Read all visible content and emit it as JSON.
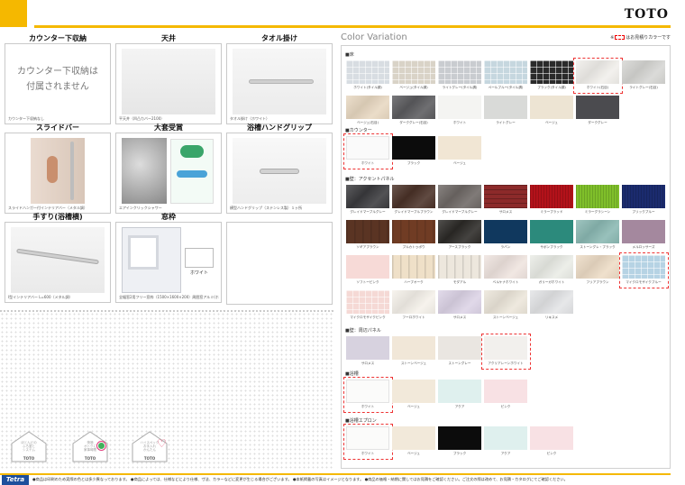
{
  "header": {
    "brand": "TOTO",
    "accent_color": "#f5b800"
  },
  "features": [
    {
      "title": "カウンター下収納",
      "note": "カウンター下収納は\n付属されません",
      "caption": "カウンター下収納なし"
    },
    {
      "title": "天井",
      "caption": "平天井（凹凸カバー2100）"
    },
    {
      "title": "タオル掛け",
      "caption": "タオル掛け（ホワイト）"
    },
    {
      "title": "スライドバー",
      "caption": "スライドハンガー付インテリアバー（メタル調）"
    },
    {
      "title": "大套受賞",
      "caption": "エアインクリックシャワー"
    },
    {
      "title": "浴槽ハンドグリップ",
      "caption": "横型ハンドグリップ（ステンレス製）１ヶ所"
    },
    {
      "title": "手すり(浴槽横)",
      "caption": "I型インテリアバー L=600（メタル調）"
    },
    {
      "title": "窓枠",
      "caption": "全幅窓2用フリー窓枠（1500×1600×200）周囲窓アルミ(ホワイト)",
      "badge": "ホワイト"
    }
  ],
  "houses": [
    {
      "label": "ほとんどの\nふろ釜と\nシステム",
      "brand": "TOTO"
    },
    {
      "label": "快適\nオトクに\n家事時間",
      "brand": "TOTO"
    },
    {
      "label": "ハイスペック\nお手入れ\nかんたん",
      "brand": "TOTO"
    }
  ],
  "color_variation": {
    "title": "Color Variation",
    "note_prefix": "※",
    "note_suffix": "はお見積りカラーです",
    "sections": [
      {
        "name": "床",
        "rows": [
          [
            {
              "l": "ホワイト(タイル調)",
              "c": "#d8dde2",
              "p": "grid"
            },
            {
              "l": "ベージュ(タイル調)",
              "c": "#d9d3c7",
              "p": "grid"
            },
            {
              "l": "ライトグレー(タイル調)",
              "c": "#c9ccd0",
              "p": "grid"
            },
            {
              "l": "ペールブルー(タイル調)",
              "c": "#c6d7df",
              "p": "grid"
            },
            {
              "l": "ブラック(タイル調)",
              "c": "#2a2a2a",
              "p": "grid"
            },
            {
              "l": "ホワイト(石目)",
              "c": "#f1efeb",
              "p": "stone",
              "sel": true
            },
            {
              "l": "ライトグレー(石目)",
              "c": "#d6d6d3",
              "p": "stone"
            }
          ],
          [
            {
              "l": "ベージュ(石目)",
              "c": "#e8d8c1",
              "p": "stone"
            },
            {
              "l": "ダークグレー(石目)",
              "c": "#5b5b5e",
              "p": "stone"
            },
            {
              "l": "ホワイト",
              "c": "#f4f4f2"
            },
            {
              "l": "ライトグレー",
              "c": "#d9dad8"
            },
            {
              "l": "ベージュ",
              "c": "#ede4d3"
            },
            {
              "l": "ダークグレー",
              "c": "#4b4b4f"
            }
          ]
        ]
      },
      {
        "name": "カウンター",
        "rows": [
          [
            {
              "l": "ホワイト",
              "c": "#fafafa",
              "sel": true
            },
            {
              "l": "ブラック",
              "c": "#0c0c0c"
            },
            {
              "l": "ベージュ",
              "c": "#f1e6d4"
            }
          ]
        ]
      },
      {
        "name": "壁：アクセントパネル",
        "rows": [
          [
            {
              "l": "グレイドマーブルグレー",
              "c": "#3a3a3d",
              "p": "stone"
            },
            {
              "l": "グレイドマーブルブラウン",
              "c": "#4a3127",
              "p": "stone"
            },
            {
              "l": "グレイドマーブルグレー",
              "c": "#6e6865",
              "p": "stone"
            },
            {
              "l": "サロメス",
              "c": "#8c2a2a",
              "p": "brick"
            },
            {
              "l": "ミラーブラッド",
              "c": "#b3121a",
              "p": "stripe"
            },
            {
              "l": "ミラーグラシーン",
              "c": "#7fbf2a",
              "p": "stripe"
            },
            {
              "l": "ブリックブルー",
              "c": "#1b2b6e",
              "p": "stripe"
            }
          ],
          [
            {
              "l": "ソギアブラウン",
              "c": "#5a3423",
              "p": "wood"
            },
            {
              "l": "ブルカトゥボウ",
              "c": "#703c24",
              "p": "wood"
            },
            {
              "l": "アースブラック",
              "c": "#2b2926",
              "p": "stone"
            },
            {
              "l": "ラバン",
              "c": "#10385e"
            },
            {
              "l": "サボンブラック",
              "c": "#2c8a7c"
            },
            {
              "l": "ストーングレ・ブラック",
              "c": "#8ab8b2",
              "p": "stone"
            },
            {
              "l": "メルロッサーズ",
              "c": "#a4889e"
            }
          ],
          [
            {
              "l": "ソフトーピンク",
              "c": "#f7dad7"
            },
            {
              "l": "ハーブオーク",
              "c": "#efe0c8",
              "p": "wood"
            },
            {
              "l": "モダアル",
              "c": "#ede7dd",
              "p": "wood"
            },
            {
              "l": "ベルケナホワイト",
              "c": "#efe4df",
              "p": "stone"
            },
            {
              "l": "ガリーガホワイト",
              "c": "#eaece6",
              "p": "stone"
            },
            {
              "l": "フリアブラウン",
              "c": "#eddcc6",
              "p": "stone"
            },
            {
              "l": "マイクロモザイクブルー",
              "c": "#b6d3e4",
              "p": "grid",
              "sel": true
            }
          ],
          [
            {
              "l": "マイクロモザイクピンク",
              "c": "#f5d9d5",
              "p": "grid"
            },
            {
              "l": "フーロホワイト",
              "c": "#f5f1ea",
              "p": "stone"
            },
            {
              "l": "サロメス",
              "c": "#dcd3e6",
              "p": "stone"
            },
            {
              "l": "ストーンベージュ",
              "c": "#ece6da",
              "p": "stone"
            },
            {
              "l": "リキスメ",
              "c": "#e3e4e6",
              "p": "stone"
            }
          ]
        ]
      },
      {
        "name": "壁：周辺パネル",
        "rows": [
          [
            {
              "l": "サロメス",
              "c": "#d7d2df"
            },
            {
              "l": "ストーンベージュ",
              "c": "#f1e7d8"
            },
            {
              "l": "ストーングレー",
              "c": "#eae6e1"
            },
            {
              "l": "アクリアレーンホワイト",
              "c": "#f2f0ed",
              "sel": true
            }
          ]
        ]
      },
      {
        "name": "浴槽",
        "rows": [
          [
            {
              "l": "ホワイト",
              "c": "#fbfbfa",
              "sel": true
            },
            {
              "l": "ベージュ",
              "c": "#f2e9da"
            },
            {
              "l": "アクア",
              "c": "#dff0ee"
            },
            {
              "l": "ピンク",
              "c": "#f8e1e4"
            }
          ]
        ]
      },
      {
        "name": "浴槽エプロン",
        "rows": [
          [
            {
              "l": "ホワイト",
              "c": "#fbfbfa",
              "sel": true
            },
            {
              "l": "ベージュ",
              "c": "#f2e9da"
            },
            {
              "l": "ブラック",
              "c": "#0c0c0c"
            },
            {
              "l": "アクア",
              "c": "#dff0ee"
            },
            {
              "l": "ピンク",
              "c": "#f8e1e4"
            }
          ]
        ]
      }
    ]
  },
  "footer": {
    "logo": "Tetra",
    "note": "●商品は印刷のため実際の色とは多少異なっております。 ●商品によっては、仕様などにより仕様、寸法、カラーなどに変更が生じる場合がございます。 ●本紙掲載の写真はイメージとなります。 ●商品の価格・納期に関してはお見積をご確認ください。ご注文の際は改めて、お見積・カタログにてご確認ください。"
  }
}
